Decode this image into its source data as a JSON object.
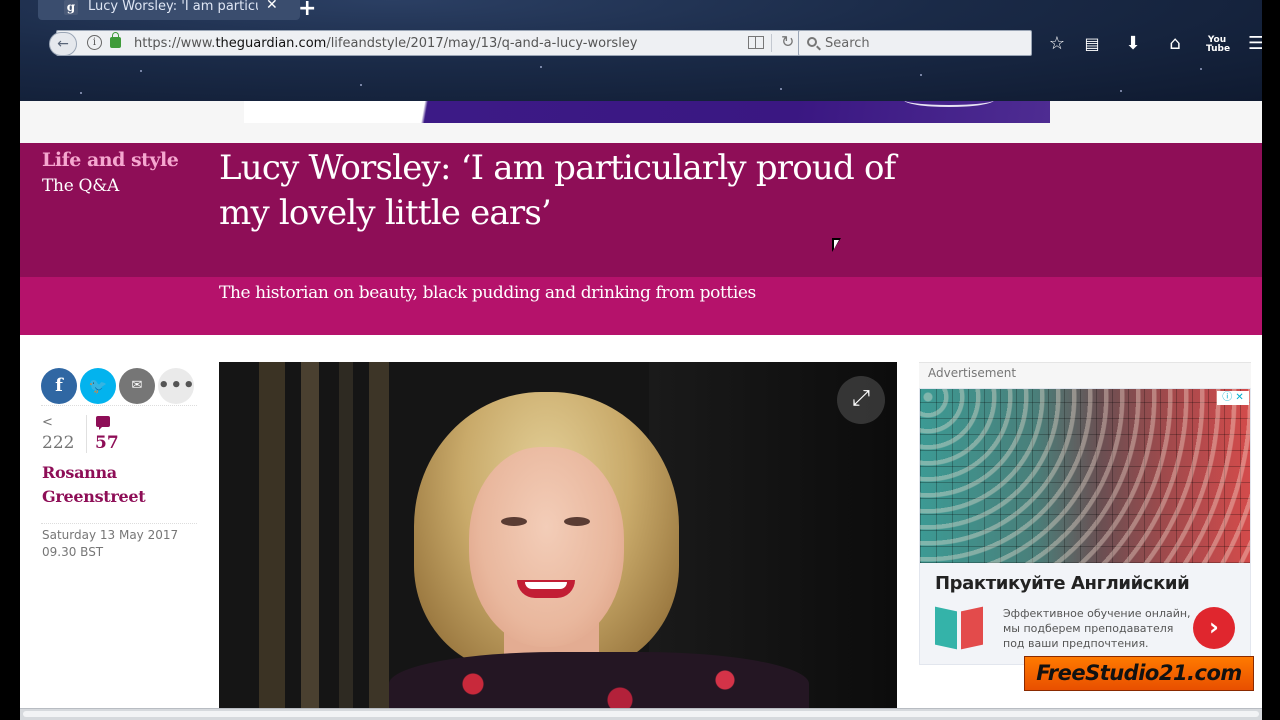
{
  "browser": {
    "tab": {
      "title": "Lucy Worsley: 'I am particul",
      "favicon_letter": "g"
    },
    "new_tab_symbol": "+",
    "close_symbol": "✕",
    "url": {
      "prefix": "https://www.",
      "host": "theguardian.com",
      "path": "/lifeandstyle/2017/may/13/q-and-a-lucy-worsley"
    },
    "search_placeholder": "Search",
    "toolbar_icons": [
      "bookmark-star-icon",
      "library-icon",
      "download-icon",
      "home-icon",
      "youtube-icon",
      "menu-icon"
    ],
    "youtube_label": "You Tube"
  },
  "article": {
    "section": "Life and style",
    "series": "The Q&A",
    "headline": "Lucy Worsley: ‘I am particularly proud of my lovely little ears’",
    "standfirst": "The historian on beauty, black pudding and drinking from potties",
    "share_count": "222",
    "comment_count": "57",
    "byline": "Rosanna Greenstreet",
    "date_line1": "Saturday 13 May 2017",
    "date_line2": "09.30 BST",
    "colors": {
      "section_band": "#8e0e57",
      "standfirst_band": "#b5126b",
      "section_label": "#f5a7cf"
    }
  },
  "share": {
    "facebook_glyph": "f",
    "twitter_glyph": "🐦",
    "email_glyph": "✉",
    "more_glyph": "•••"
  },
  "ad": {
    "label": "Advertisement",
    "badge": "ⓘ ✕",
    "headline": "Практикуйте Английский",
    "body": "Эффективное обучение онлайн, мы подберем преподавателя под ваши предпочтения.",
    "arrow": "›"
  },
  "watermark": "FreeStudio21.com"
}
